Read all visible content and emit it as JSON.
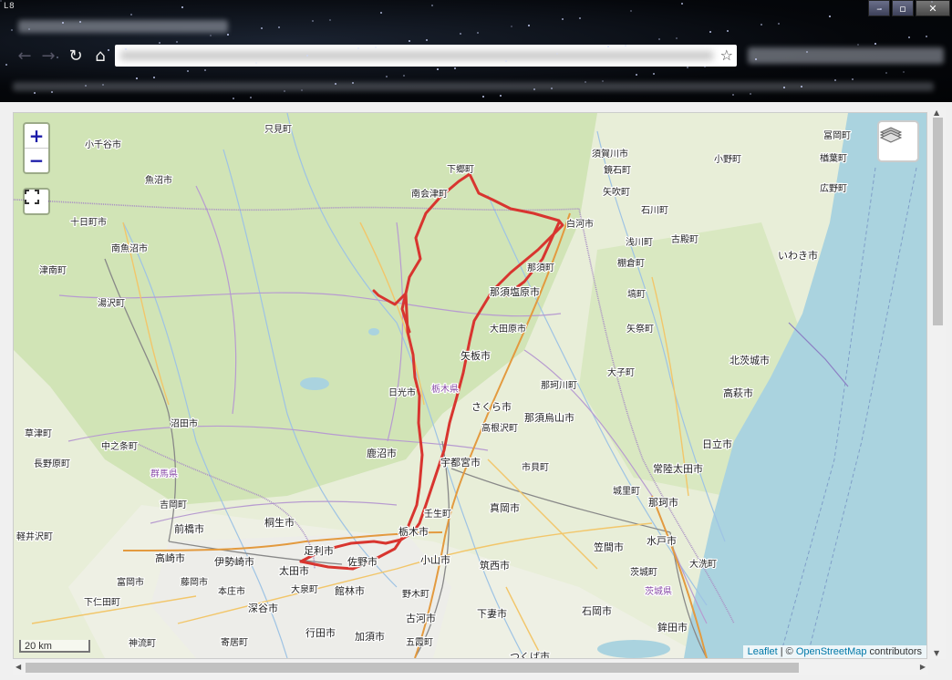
{
  "window": {
    "app_logo": "L8",
    "controls": [
      "–",
      "▫",
      "✕"
    ]
  },
  "toolbar": {
    "back": "←",
    "forward": "→",
    "reload": "↻",
    "home": "⌂",
    "bookmark": "☆"
  },
  "map": {
    "zoom_in": "+",
    "zoom_out": "−",
    "scale_label": "20 km",
    "attribution": {
      "leaflet": "Leaflet",
      "separator": " | © ",
      "osm": "OpenStreetMap",
      "suffix": " contributors"
    },
    "places": [
      {
        "name": "只見町",
        "cls": "place"
      },
      {
        "name": "小千谷市",
        "cls": "place"
      },
      {
        "name": "魚沼市",
        "cls": "place"
      },
      {
        "name": "十日町市",
        "cls": "place"
      },
      {
        "name": "南魚沼市",
        "cls": "place"
      },
      {
        "name": "津南町",
        "cls": "place"
      },
      {
        "name": "湯沢町",
        "cls": "place"
      },
      {
        "name": "南会津町",
        "cls": "place"
      },
      {
        "name": "下郷町",
        "cls": "place"
      },
      {
        "name": "須賀川市",
        "cls": "place"
      },
      {
        "name": "鏡石町",
        "cls": "place"
      },
      {
        "name": "矢吹町",
        "cls": "place"
      },
      {
        "name": "石川町",
        "cls": "place"
      },
      {
        "name": "白河市",
        "cls": "place"
      },
      {
        "name": "浅川町",
        "cls": "place"
      },
      {
        "name": "古殿町",
        "cls": "place"
      },
      {
        "name": "棚倉町",
        "cls": "place"
      },
      {
        "name": "塙町",
        "cls": "place"
      },
      {
        "name": "那須町",
        "cls": "place"
      },
      {
        "name": "那須塩原市",
        "cls": "place big"
      },
      {
        "name": "大田原市",
        "cls": "place"
      },
      {
        "name": "矢板市",
        "cls": "place big"
      },
      {
        "name": "矢祭町",
        "cls": "place"
      },
      {
        "name": "大子町",
        "cls": "place"
      },
      {
        "name": "那珂川町",
        "cls": "place"
      },
      {
        "name": "日光市",
        "cls": "place"
      },
      {
        "name": "栃木県",
        "cls": "pref"
      },
      {
        "name": "さくら市",
        "cls": "place big"
      },
      {
        "name": "高根沢町",
        "cls": "place"
      },
      {
        "name": "那須烏山市",
        "cls": "place big"
      },
      {
        "name": "沼田市",
        "cls": "place"
      },
      {
        "name": "草津町",
        "cls": "place"
      },
      {
        "name": "中之条町",
        "cls": "place"
      },
      {
        "name": "長野原町",
        "cls": "place"
      },
      {
        "name": "群馬県",
        "cls": "pref"
      },
      {
        "name": "鹿沼市",
        "cls": "place big"
      },
      {
        "name": "宇都宮市",
        "cls": "place big"
      },
      {
        "name": "市貝町",
        "cls": "place"
      },
      {
        "name": "吉岡町",
        "cls": "place"
      },
      {
        "name": "前橋市",
        "cls": "place big"
      },
      {
        "name": "桐生市",
        "cls": "place big"
      },
      {
        "name": "壬生町",
        "cls": "place"
      },
      {
        "name": "真岡市",
        "cls": "place big"
      },
      {
        "name": "栃木市",
        "cls": "place big"
      },
      {
        "name": "軽井沢町",
        "cls": "place"
      },
      {
        "name": "高崎市",
        "cls": "place big"
      },
      {
        "name": "伊勢崎市",
        "cls": "place big"
      },
      {
        "name": "足利市",
        "cls": "place big"
      },
      {
        "name": "佐野市",
        "cls": "place big"
      },
      {
        "name": "小山市",
        "cls": "place big"
      },
      {
        "name": "筑西市",
        "cls": "place big"
      },
      {
        "name": "太田市",
        "cls": "place big"
      },
      {
        "name": "富岡市",
        "cls": "place"
      },
      {
        "name": "藤岡市",
        "cls": "place"
      },
      {
        "name": "本庄市",
        "cls": "place"
      },
      {
        "name": "大泉町",
        "cls": "place"
      },
      {
        "name": "館林市",
        "cls": "place big"
      },
      {
        "name": "下仁田町",
        "cls": "place"
      },
      {
        "name": "深谷市",
        "cls": "place big"
      },
      {
        "name": "野木町",
        "cls": "place"
      },
      {
        "name": "神流町",
        "cls": "place"
      },
      {
        "name": "寄居町",
        "cls": "place"
      },
      {
        "name": "行田市",
        "cls": "place big"
      },
      {
        "name": "加須市",
        "cls": "place big"
      },
      {
        "name": "古河市",
        "cls": "place big"
      },
      {
        "name": "下妻市",
        "cls": "place big"
      },
      {
        "name": "五霞町",
        "cls": "place"
      },
      {
        "name": "つくば市",
        "cls": "place big"
      },
      {
        "name": "冨岡町",
        "cls": "place"
      },
      {
        "name": "楢葉町",
        "cls": "place"
      },
      {
        "name": "広野町",
        "cls": "place"
      },
      {
        "name": "小野町",
        "cls": "place"
      },
      {
        "name": "いわき市",
        "cls": "place big"
      },
      {
        "name": "北茨城市",
        "cls": "place big"
      },
      {
        "name": "高萩市",
        "cls": "place big"
      },
      {
        "name": "日立市",
        "cls": "place big"
      },
      {
        "name": "常陸太田市",
        "cls": "place big"
      },
      {
        "name": "城里町",
        "cls": "place"
      },
      {
        "name": "那珂市",
        "cls": "place big"
      },
      {
        "name": "水戸市",
        "cls": "place big"
      },
      {
        "name": "笠間市",
        "cls": "place big"
      },
      {
        "name": "茨城町",
        "cls": "place"
      },
      {
        "name": "大洗町",
        "cls": "place"
      },
      {
        "name": "茨城県",
        "cls": "pref"
      },
      {
        "name": "石岡市",
        "cls": "place big"
      },
      {
        "name": "鉾田市",
        "cls": "place big"
      }
    ]
  },
  "colors": {
    "route": "#d8352f",
    "land": "#e6ecd6",
    "forest": "#cfe2b3",
    "sea": "#aad3df",
    "highway": "#e8a34b",
    "road": "#f3cf7a",
    "rail": "#888888",
    "water": "#9ec3e4",
    "boundary": "#a98fc4"
  }
}
